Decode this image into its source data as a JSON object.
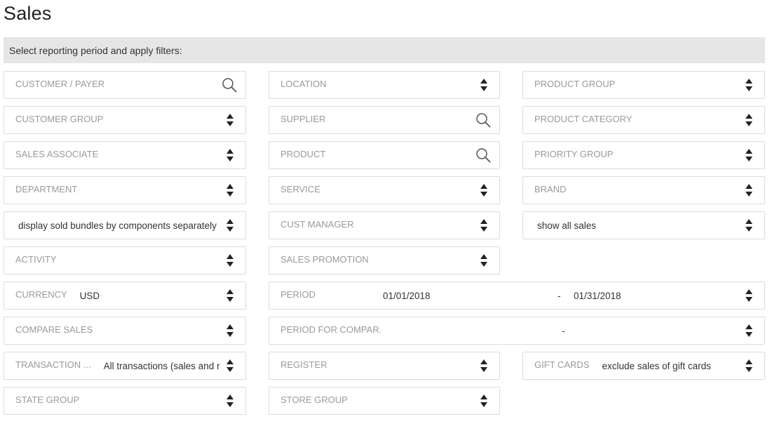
{
  "page": {
    "title": "Sales",
    "banner": "Select reporting period and apply filters:"
  },
  "filters": {
    "customer_payer": {
      "label": "CUSTOMER / PAYER",
      "icon": "search-icon"
    },
    "location": {
      "label": "LOCATION",
      "icon": "sort-icon"
    },
    "product_group": {
      "label": "PRODUCT GROUP",
      "icon": "sort-icon"
    },
    "customer_group": {
      "label": "CUSTOMER GROUP",
      "icon": "sort-icon"
    },
    "supplier": {
      "label": "SUPPLIER",
      "icon": "search-icon"
    },
    "product_category": {
      "label": "PRODUCT CATEGORY",
      "icon": "sort-icon"
    },
    "sales_associate": {
      "label": "SALES ASSOCIATE",
      "icon": "sort-icon"
    },
    "product": {
      "label": "PRODUCT",
      "icon": "search-icon"
    },
    "priority_group": {
      "label": "PRIORITY GROUP",
      "icon": "sort-icon"
    },
    "department": {
      "label": "DEPARTMENT",
      "icon": "sort-icon"
    },
    "service": {
      "label": "SERVICE",
      "icon": "sort-icon"
    },
    "brand": {
      "label": "BRAND",
      "icon": "sort-icon"
    },
    "bundles": {
      "value": "display sold bundles by components separately",
      "icon": "sort-icon"
    },
    "cust_manager": {
      "label": "CUST MANAGER",
      "icon": "sort-icon"
    },
    "sales_scope": {
      "value": "show all sales",
      "icon": "sort-icon"
    },
    "activity": {
      "label": "ACTIVITY",
      "icon": "sort-icon"
    },
    "sales_promotion": {
      "label": "SALES PROMOTION",
      "icon": "sort-icon"
    },
    "currency": {
      "label": "CURRENCY",
      "value": "USD",
      "icon": "sort-icon"
    },
    "period": {
      "label": "PERIOD",
      "from": "01/01/2018",
      "separator": "-",
      "to": "01/31/2018",
      "icon": "sort-icon"
    },
    "compare_sales": {
      "label": "COMPARE SALES",
      "icon": "sort-icon"
    },
    "period_compare": {
      "label": "PERIOD FOR COMPAR.",
      "separator": "-",
      "icon": "sort-icon"
    },
    "transaction": {
      "label": "TRANSACTION ...",
      "value": "All transactions (sales and r",
      "icon": "sort-icon"
    },
    "register": {
      "label": "REGISTER",
      "icon": "sort-icon"
    },
    "gift_cards": {
      "label": "GIFT CARDS",
      "value": "exclude sales of gift cards",
      "icon": "sort-icon"
    },
    "state_group": {
      "label": "STATE GROUP",
      "icon": "sort-icon"
    },
    "store_group": {
      "label": "STORE GROUP",
      "icon": "sort-icon"
    }
  },
  "colors": {
    "banner_bg": "#e6e6e6",
    "border": "#dcdcdc",
    "label": "#9a9a9a",
    "text": "#333333"
  }
}
